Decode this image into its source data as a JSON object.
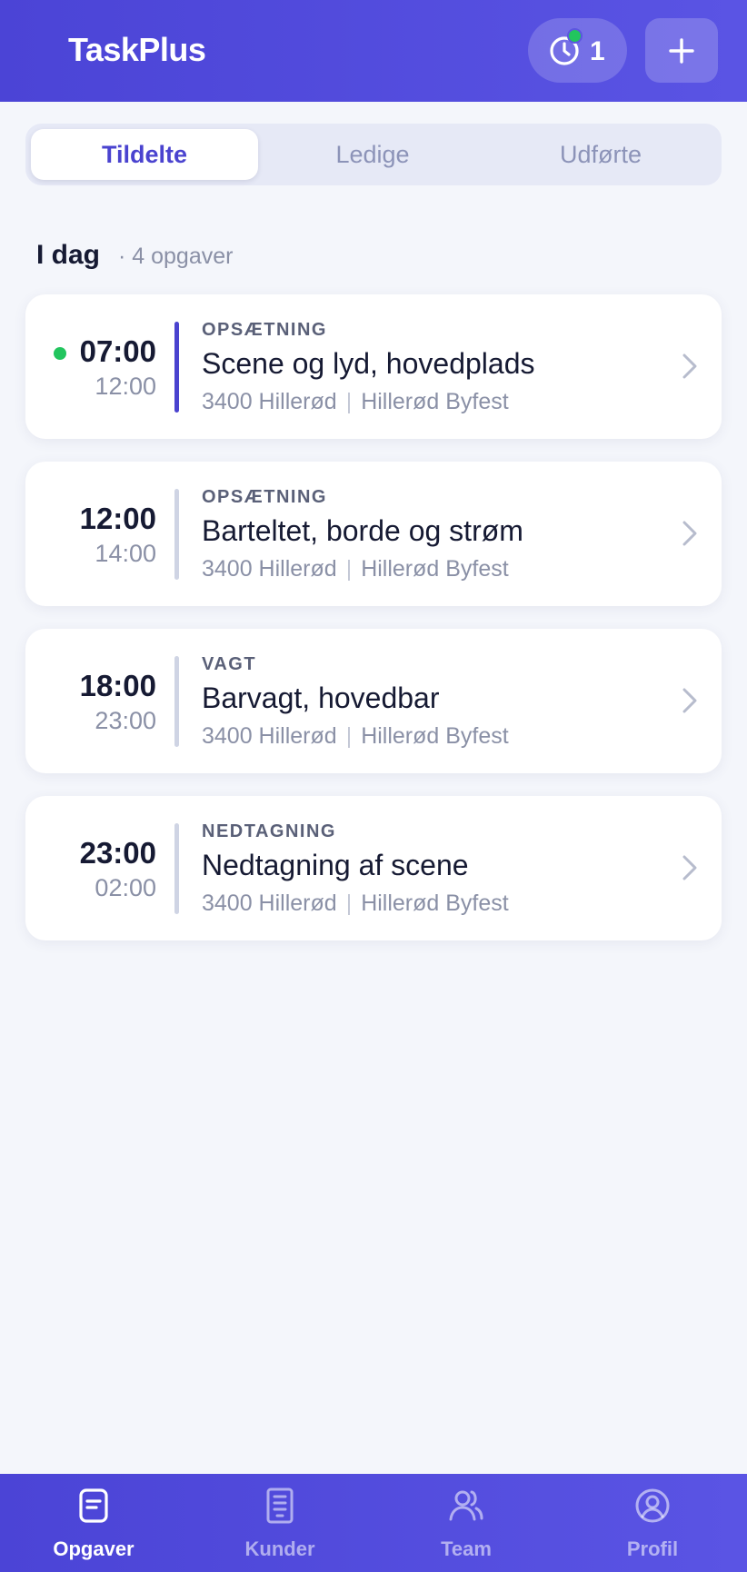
{
  "header": {
    "app_title": "TaskPlus",
    "timer_count": "1",
    "timer_icon": "clock-icon",
    "add_icon": "plus-icon"
  },
  "tabs": [
    {
      "label": "Tildelte",
      "active": true
    },
    {
      "label": "Ledige",
      "active": false
    },
    {
      "label": "Udførte",
      "active": false
    }
  ],
  "section": {
    "title": "I dag",
    "count_text": "· 4 opgaver"
  },
  "tasks": [
    {
      "start": "07:00",
      "end": "12:00",
      "category": "OPSÆTNING",
      "title": "Scene og lyd, hovedplads",
      "location": "3400 Hillerød",
      "event": "Hillerød Byfest",
      "in_progress": true
    },
    {
      "start": "12:00",
      "end": "14:00",
      "category": "OPSÆTNING",
      "title": "Barteltet, borde og strøm",
      "location": "3400 Hillerød",
      "event": "Hillerød Byfest",
      "in_progress": false
    },
    {
      "start": "18:00",
      "end": "23:00",
      "category": "VAGT",
      "title": "Barvagt, hovedbar",
      "location": "3400 Hillerød",
      "event": "Hillerød Byfest",
      "in_progress": false
    },
    {
      "start": "23:00",
      "end": "02:00",
      "category": "NEDTAGNING",
      "title": "Nedtagning af scene",
      "location": "3400 Hillerød",
      "event": "Hillerød Byfest",
      "in_progress": false
    }
  ],
  "separator": "|",
  "bottom_nav": [
    {
      "label": "Opgaver",
      "icon": "clipboard-icon",
      "active": true
    },
    {
      "label": "Kunder",
      "icon": "building-icon",
      "active": false
    },
    {
      "label": "Team",
      "icon": "users-icon",
      "active": false
    },
    {
      "label": "Profil",
      "icon": "user-circle-icon",
      "active": false
    }
  ],
  "colors": {
    "brand": "#4b44d6",
    "accent_text": "#4a43cf",
    "live": "#22c55e",
    "background": "#f4f6fb"
  }
}
